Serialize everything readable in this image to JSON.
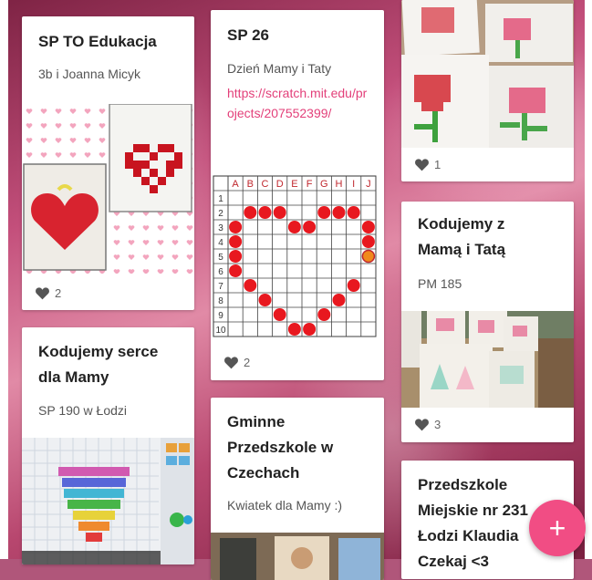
{
  "cards": {
    "sp_to": {
      "title": "SP TO Edukacja",
      "subtitle": "3b i Joanna Micyk",
      "likes": "2"
    },
    "sp26": {
      "title": "SP 26",
      "subtitle": "Dzień Mamy i Taty",
      "link": "https://scratch.mit.edu/projects/207552399/",
      "likes": "2"
    },
    "tulips": {
      "likes": "1"
    },
    "kodujemy_mama": {
      "title": "Kodujemy z Mamą i Tatą",
      "subtitle": "PM 185",
      "likes": "3"
    },
    "serce": {
      "title": "Kodujemy serce dla Mamy",
      "subtitle": "SP 190 w Łodzi"
    },
    "gminne": {
      "title": "Gminne Przedszkole w Czechach",
      "subtitle": "Kwiatek dla Mamy :)"
    },
    "miejskie": {
      "title": "Przedszkole Miejskie nr 231 Łodzi Klaudia Czekaj <3"
    }
  },
  "grid": {
    "columns": [
      "A",
      "B",
      "C",
      "D",
      "E",
      "F",
      "G",
      "H",
      "I",
      "J"
    ],
    "rows": [
      "1",
      "2",
      "3",
      "4",
      "5",
      "6",
      "7",
      "8",
      "9",
      "10"
    ]
  },
  "fab": {
    "label": "+"
  },
  "colors": {
    "accent": "#f14d84",
    "link": "#e3407a",
    "heart_cell": "#e8181f"
  },
  "icons": {
    "like": "heart-icon",
    "add": "plus-icon"
  }
}
